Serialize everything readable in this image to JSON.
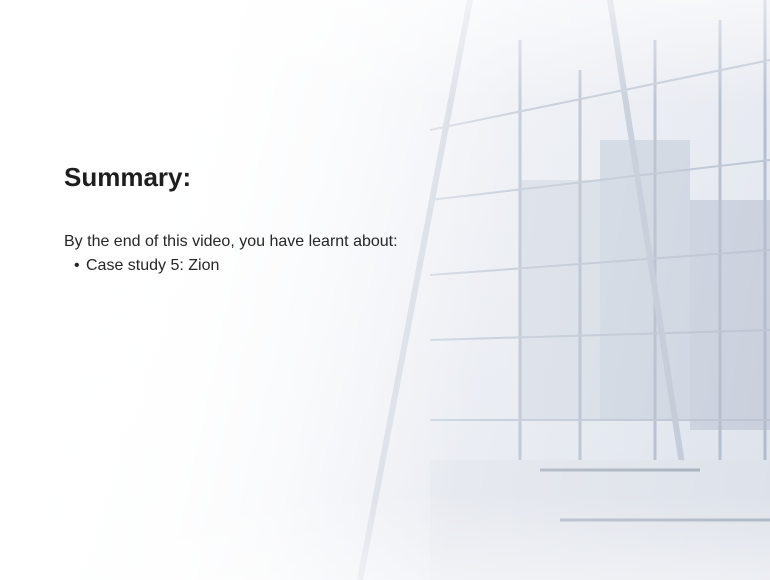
{
  "slide": {
    "title": "Summary:",
    "intro": "By the end of this video, you have learnt about:",
    "bullets": [
      {
        "marker": "•",
        "text": "Case study 5: Zion"
      }
    ]
  },
  "background": {
    "image": "glass-building-facade",
    "colors": {
      "sky": "#e6ebf3",
      "frame": "#9aa6b8",
      "glass": "#c9d2df"
    }
  }
}
